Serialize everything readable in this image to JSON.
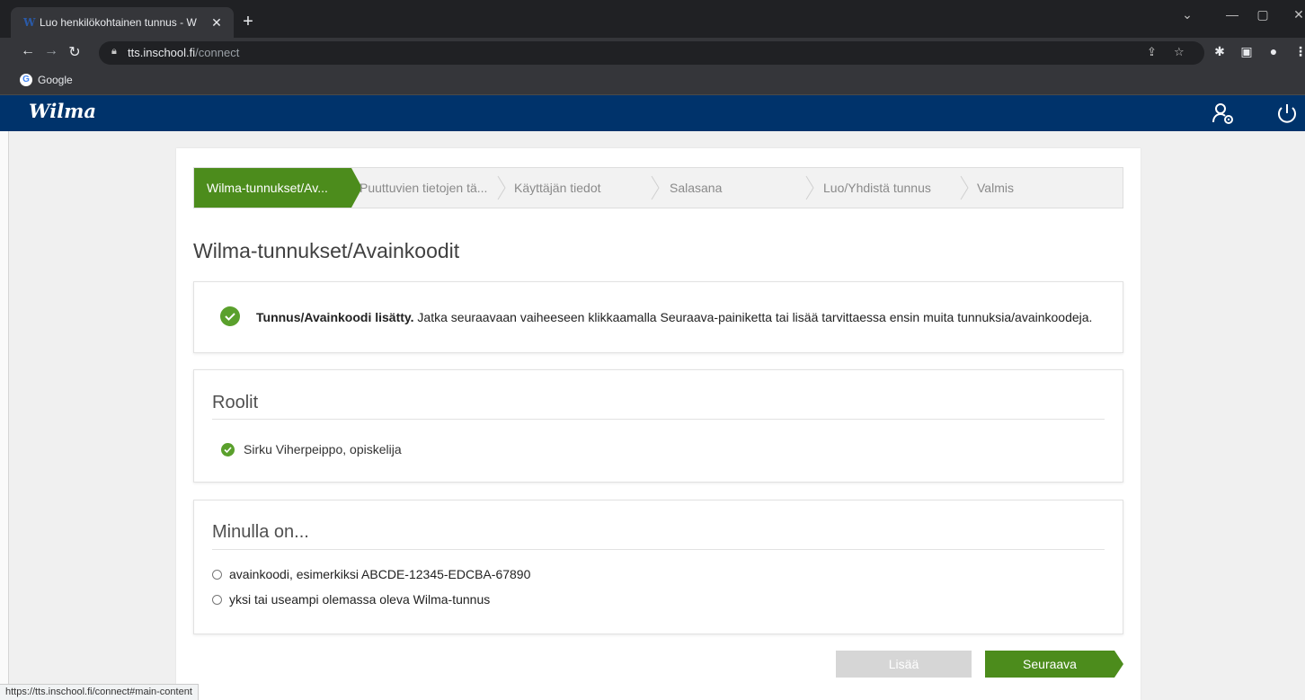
{
  "browser": {
    "tab_title": "Luo henkilökohtainen tunnus - W",
    "tab_favicon": "W",
    "url_host": "tts.inschool.fi",
    "url_path": "/connect",
    "bookmark_label": "Google",
    "status_url": "https://tts.inschool.fi/connect#main-content"
  },
  "header": {
    "logo": "Wilma",
    "bg_color": "#00336b"
  },
  "wizard": {
    "active_color": "#4c8c1c",
    "steps": [
      {
        "label": "Wilma-tunnukset/Av...",
        "active": true
      },
      {
        "label": "Puuttuvien tietojen tä...",
        "active": false
      },
      {
        "label": "Käyttäjän tiedot",
        "active": false
      },
      {
        "label": "Salasana",
        "active": false
      },
      {
        "label": "Luo/Yhdistä tunnus",
        "active": false
      },
      {
        "label": "Valmis",
        "active": false
      }
    ]
  },
  "page": {
    "heading": "Wilma-tunnukset/Avainkoodit"
  },
  "notice": {
    "bold_text": "Tunnus/Avainkoodi lisätty.",
    "text": " Jatka seuraavaan vaiheeseen klikkaamalla Seuraava-painiketta tai lisää tarvittaessa ensin muita tunnuksia/avainkoodeja."
  },
  "roles": {
    "title": "Roolit",
    "items": [
      "Sirku Viherpeippo, opiskelija"
    ]
  },
  "minulla": {
    "title": "Minulla on...",
    "options": [
      "avainkoodi, esimerkiksi ABCDE-12345-EDCBA-67890",
      "yksi tai useampi olemassa oleva Wilma-tunnus"
    ]
  },
  "buttons": {
    "add": "Lisää",
    "next": "Seuraava"
  }
}
